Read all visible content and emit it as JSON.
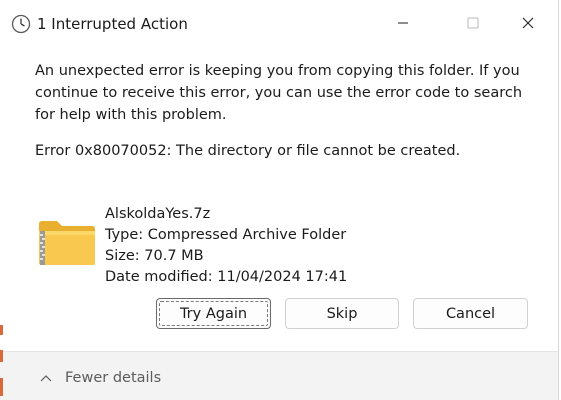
{
  "window": {
    "title": "1 Interrupted Action",
    "title_icon": "clock-icon",
    "controls": [
      "minimize-icon",
      "maximize-icon",
      "close-icon"
    ]
  },
  "message": {
    "text": "An unexpected error is keeping you from copying this folder. If you continue to receive this error, you can use the error code to search for help with this problem.",
    "error": "Error 0x80070052: The directory or file cannot be created."
  },
  "file": {
    "icon": "zip-folder-icon",
    "name": "AlskoldaYes.7z",
    "type": "Type: Compressed Archive Folder",
    "size": "Size: 70.7 MB",
    "modified": "Date modified: 11/04/2024 17:41"
  },
  "buttons": {
    "try_again": "Try Again",
    "skip": "Skip",
    "cancel": "Cancel"
  },
  "footer": {
    "details_label": "Fewer details",
    "icon": "chevron-up-icon"
  },
  "colors": {
    "background": "#ffffff",
    "footer_bg": "#f3f3f3",
    "button_border": "#d1d1d1",
    "folder_yellow": "#f8c94e"
  }
}
